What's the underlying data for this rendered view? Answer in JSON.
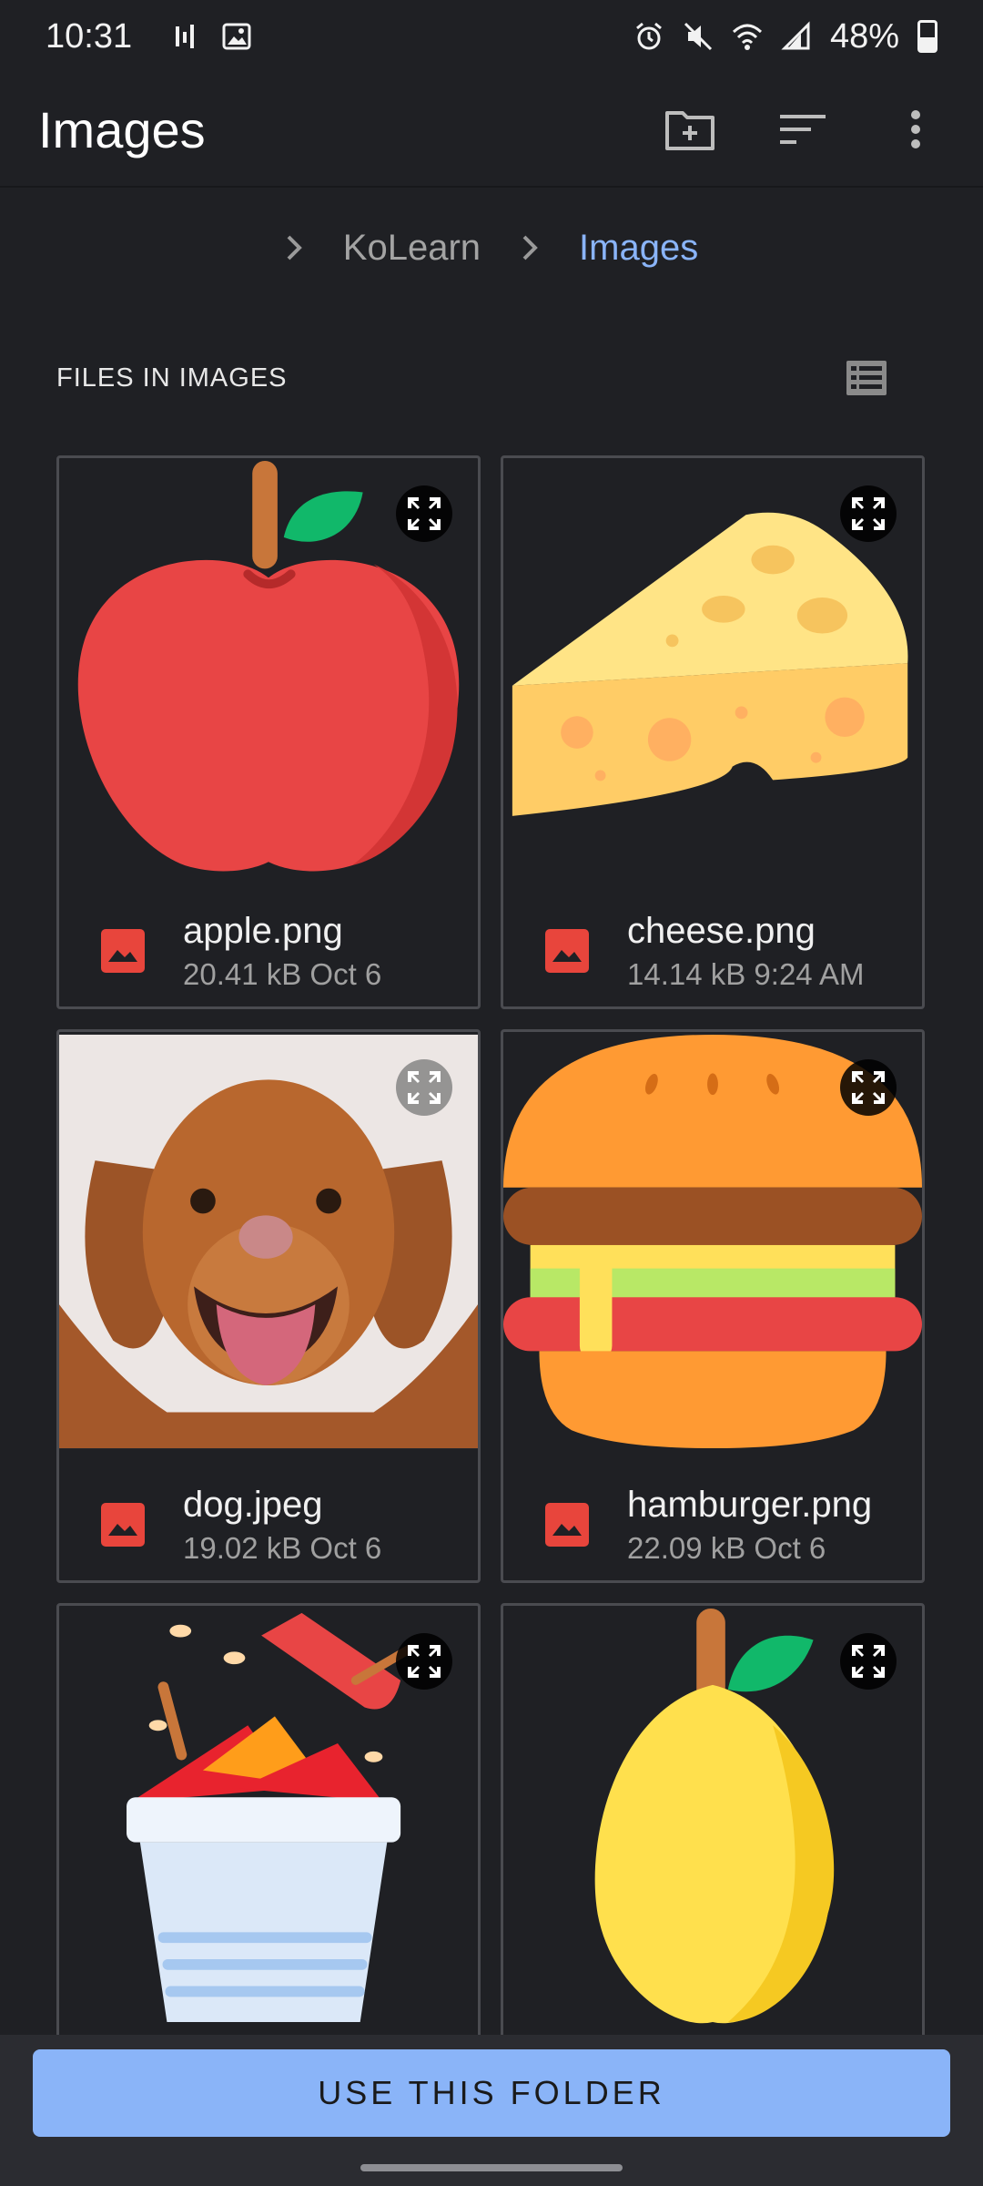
{
  "status_bar": {
    "time": "10:31",
    "battery": "48%",
    "battery_level": 0.48,
    "icons": [
      "signal-bars-icon",
      "gallery-icon",
      "alarm-icon",
      "mute-icon",
      "wifi-icon",
      "cell-signal-icon",
      "battery-icon"
    ]
  },
  "app_bar": {
    "title": "Images",
    "actions": [
      "new-folder-icon",
      "sort-icon",
      "more-vert-icon"
    ]
  },
  "breadcrumb": {
    "items": [
      "KoLearn",
      "Images"
    ]
  },
  "section": {
    "title": "FILES IN IMAGES",
    "view_toggle_icon": "list-view-icon"
  },
  "files": [
    {
      "name": "apple.png",
      "meta": "20.41 kB Oct 6",
      "thumb": "apple"
    },
    {
      "name": "cheese.png",
      "meta": "14.14 kB 9:24 AM",
      "thumb": "cheese"
    },
    {
      "name": "dog.jpeg",
      "meta": "19.02 kB Oct 6",
      "thumb": "dog"
    },
    {
      "name": "hamburger.png",
      "meta": "22.09 kB Oct 6",
      "thumb": "hamburger"
    },
    {
      "name": "",
      "meta": "",
      "thumb": "candy-apples"
    },
    {
      "name": "",
      "meta": "",
      "thumb": "lemon"
    }
  ],
  "bottom": {
    "button_label": "USE THIS FOLDER"
  },
  "colors": {
    "background": "#1f2024",
    "accent": "#8ab4f8",
    "file_icon": "#e8453c"
  }
}
